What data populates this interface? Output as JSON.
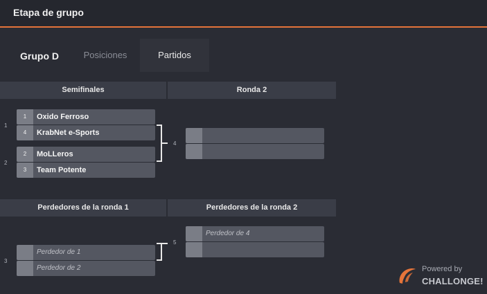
{
  "header": {
    "title": "Etapa de grupo"
  },
  "group": {
    "name": "Grupo D",
    "tabs": [
      {
        "label": "Posiciones",
        "active": false
      },
      {
        "label": "Partidos",
        "active": true
      }
    ]
  },
  "winners_bracket": {
    "rounds": [
      "Semifinales",
      "Ronda 2"
    ],
    "matches": [
      {
        "number": "1",
        "top": {
          "seed": "1",
          "name": "Oxido Ferroso"
        },
        "bottom": {
          "seed": "4",
          "name": "KrabNet e-Sports"
        }
      },
      {
        "number": "2",
        "top": {
          "seed": "2",
          "name": "MoLLeros"
        },
        "bottom": {
          "seed": "3",
          "name": "Team Potente"
        }
      },
      {
        "number": "4",
        "top": {
          "seed": "",
          "name": ""
        },
        "bottom": {
          "seed": "",
          "name": ""
        }
      }
    ]
  },
  "losers_bracket": {
    "rounds": [
      "Perdedores de la ronda 1",
      "Perdedores de la ronda 2"
    ],
    "matches": [
      {
        "number": "3",
        "top": {
          "seed": "",
          "name": "Perdedor de 1"
        },
        "bottom": {
          "seed": "",
          "name": "Perdedor de 2"
        }
      },
      {
        "number": "5",
        "top": {
          "seed": "",
          "name": "Perdedor de 4"
        },
        "bottom": {
          "seed": "",
          "name": ""
        }
      }
    ]
  },
  "branding": {
    "powered_by": "Powered by",
    "brand": "CHALLONGE!"
  },
  "colors": {
    "accent": "#e5743a",
    "background": "#2a2c34",
    "header_bg": "#25272e",
    "round_header_bg": "#3a3d47",
    "slot_bg": "#545761",
    "seed_bg": "#7a7d86"
  }
}
